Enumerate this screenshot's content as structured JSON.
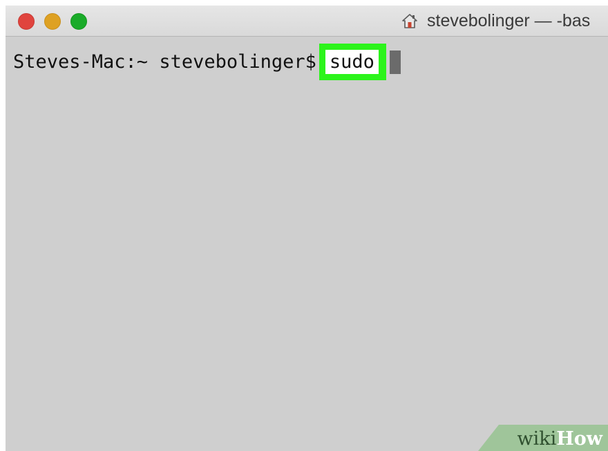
{
  "window": {
    "title": "stevebolinger — -bas",
    "controls": [
      "close",
      "minimize",
      "zoom"
    ]
  },
  "terminal": {
    "prompt": "Steves-Mac:~ stevebolinger$",
    "command": "sudo",
    "highlight_color": "#2cf41b",
    "background_color": "#cfcfcf",
    "cursor_icon": "block-cursor"
  },
  "watermark": {
    "part1": "wiki",
    "part2": "How"
  }
}
